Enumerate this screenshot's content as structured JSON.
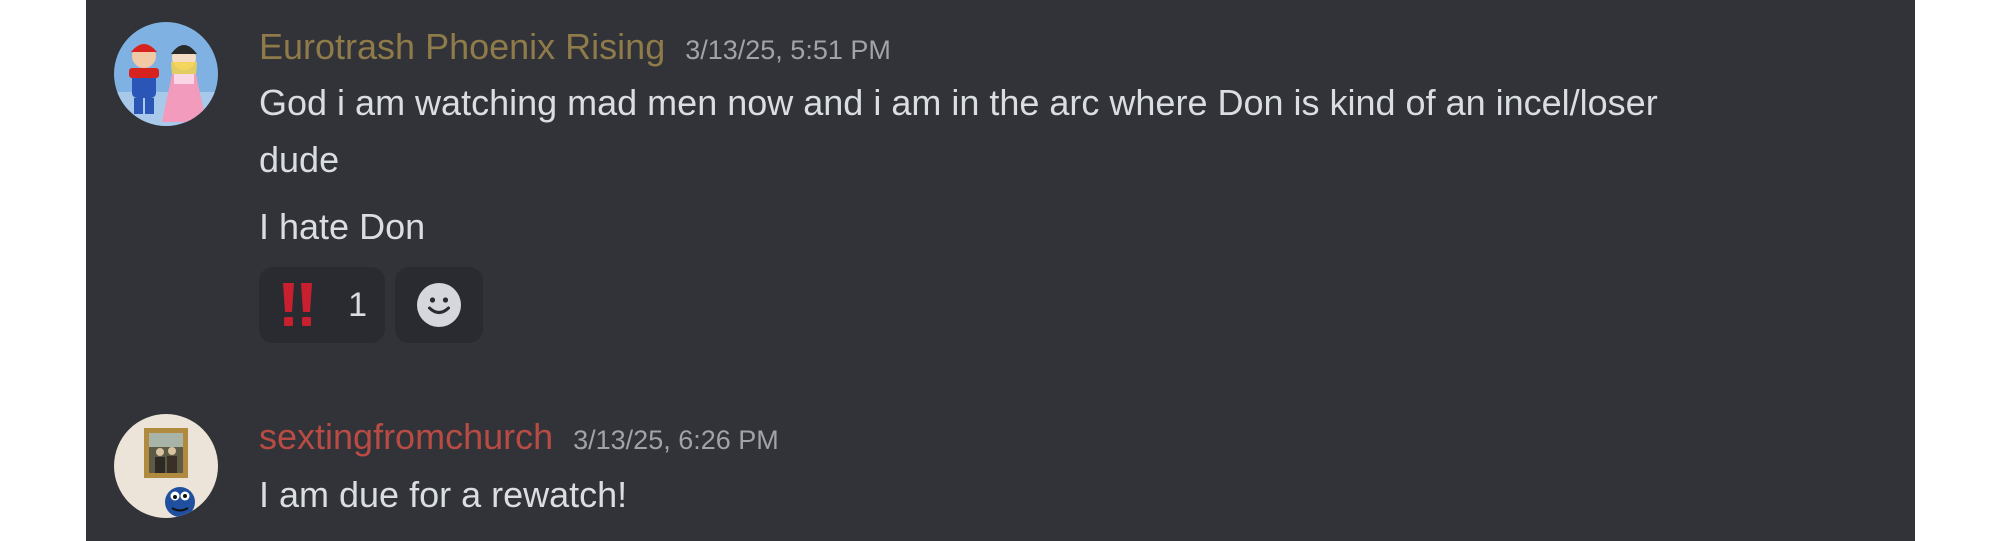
{
  "messages": [
    {
      "author": "Eurotrash Phoenix Rising",
      "timestamp": "3/13/25, 5:51 PM",
      "author_color": "#8f7a4a",
      "lines": [
        "God i am watching mad men now and i am in the arc where Don is kind of an incel/loser",
        "dude",
        "I hate Don"
      ],
      "reactions": [
        {
          "emoji": "double-exclamation-icon",
          "count": "1"
        }
      ],
      "add_reaction_icon": "add-reaction-smiley-icon"
    },
    {
      "author": "sextingfromchurch",
      "timestamp": "3/13/25, 6:26 PM",
      "author_color": "#b84b43",
      "lines": [
        "I am due for a rewatch!"
      ]
    }
  ],
  "colors": {
    "background": "#313338",
    "text": "#dbdee1",
    "timestamp": "#a0a3aa",
    "reaction_bg": "#2a2b30"
  }
}
